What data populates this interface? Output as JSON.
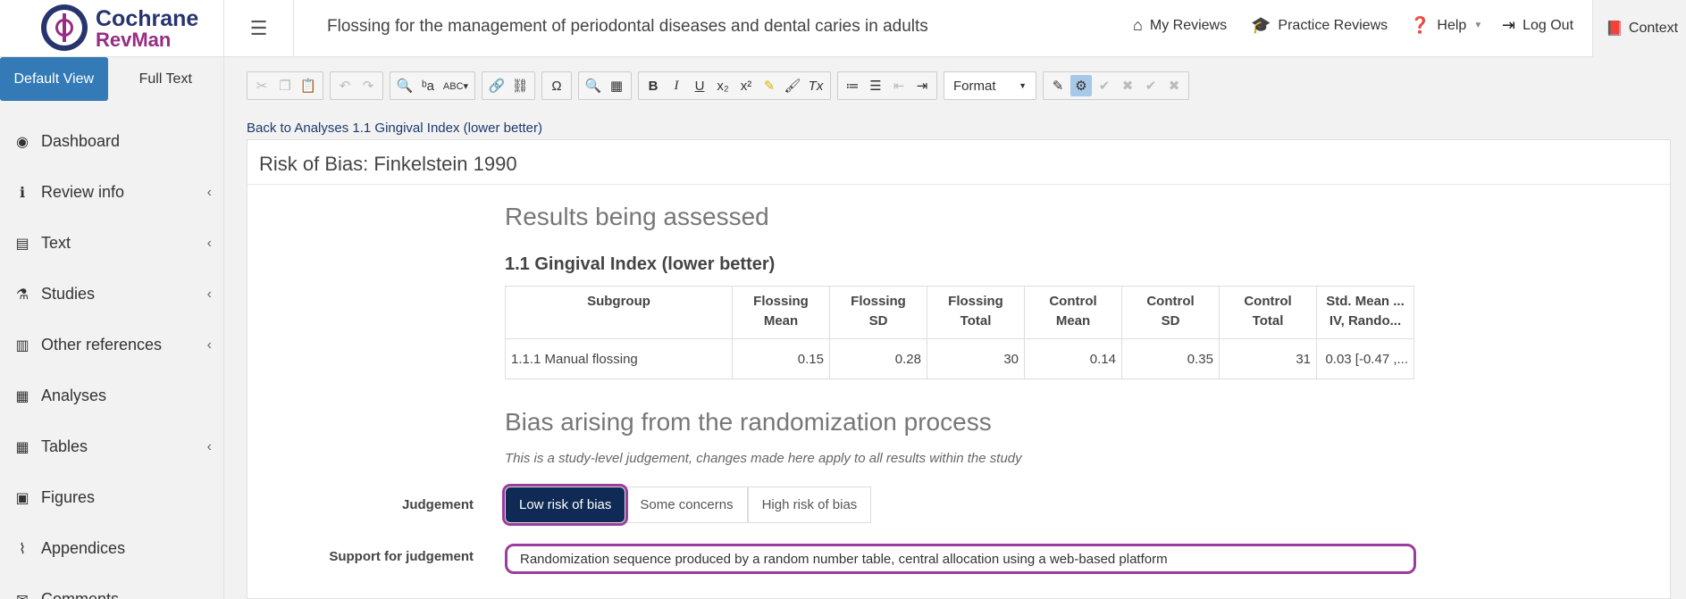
{
  "brand": {
    "line1": "Cochrane",
    "line2": "RevMan"
  },
  "header": {
    "title": "Flossing for the management of periodontal diseases and dental caries in adults",
    "nav": [
      {
        "label": "My Reviews",
        "icon": "home-icon"
      },
      {
        "label": "Practice Reviews",
        "icon": "graduation-cap-icon"
      },
      {
        "label": "Help",
        "icon": "question-circle-icon"
      },
      {
        "label": "Log Out",
        "icon": "logout-icon"
      },
      {
        "label": "Context",
        "icon": "book-icon"
      }
    ]
  },
  "sidebar": {
    "view_tabs": [
      "Default View",
      "Full Text"
    ],
    "items": [
      {
        "label": "Dashboard",
        "icon": "dashboard-icon",
        "expandable": false
      },
      {
        "label": "Review info",
        "icon": "info-icon",
        "expandable": true
      },
      {
        "label": "Text",
        "icon": "document-icon",
        "expandable": true
      },
      {
        "label": "Studies",
        "icon": "flask-icon",
        "expandable": true
      },
      {
        "label": "Other references",
        "icon": "book-icon",
        "expandable": true
      },
      {
        "label": "Analyses",
        "icon": "calculator-icon",
        "expandable": false
      },
      {
        "label": "Tables",
        "icon": "table-icon",
        "expandable": true
      },
      {
        "label": "Figures",
        "icon": "image-icon",
        "expandable": false
      },
      {
        "label": "Appendices",
        "icon": "paperclip-icon",
        "expandable": false
      },
      {
        "label": "Comments",
        "icon": "comment-icon",
        "expandable": false
      }
    ]
  },
  "toolbar": {
    "format_label": "Format"
  },
  "main": {
    "back_link": "Back to Analyses 1.1 Gingival Index (lower better)",
    "panel_title": "Risk of Bias: Finkelstein 1990",
    "results_title": "Results being assessed",
    "analysis_title": "1.1 Gingival Index (lower better)",
    "table": {
      "headers": [
        [
          "Subgroup",
          ""
        ],
        [
          "Flossing",
          "Mean"
        ],
        [
          "Flossing",
          "SD"
        ],
        [
          "Flossing",
          "Total"
        ],
        [
          "Control",
          "Mean"
        ],
        [
          "Control",
          "SD"
        ],
        [
          "Control",
          "Total"
        ],
        [
          "Std. Mean ...",
          "IV, Rando..."
        ]
      ],
      "rows": [
        [
          "1.1.1 Manual flossing",
          "0.15",
          "0.28",
          "30",
          "0.14",
          "0.35",
          "31",
          "0.03 [-0.47 ,..."
        ]
      ]
    },
    "bias_title": "Bias arising from the randomization process",
    "hint": "This is a study-level judgement, changes made here apply to all results within the study",
    "judgement_label": "Judgement",
    "judgement_options": [
      "Low risk of bias",
      "Some concerns",
      "High risk of bias"
    ],
    "judgement_selected": "Low risk of bias",
    "support_label": "Support for judgement",
    "support_value": "Randomization sequence produced by a random number table, central allocation using a web-based platform"
  }
}
